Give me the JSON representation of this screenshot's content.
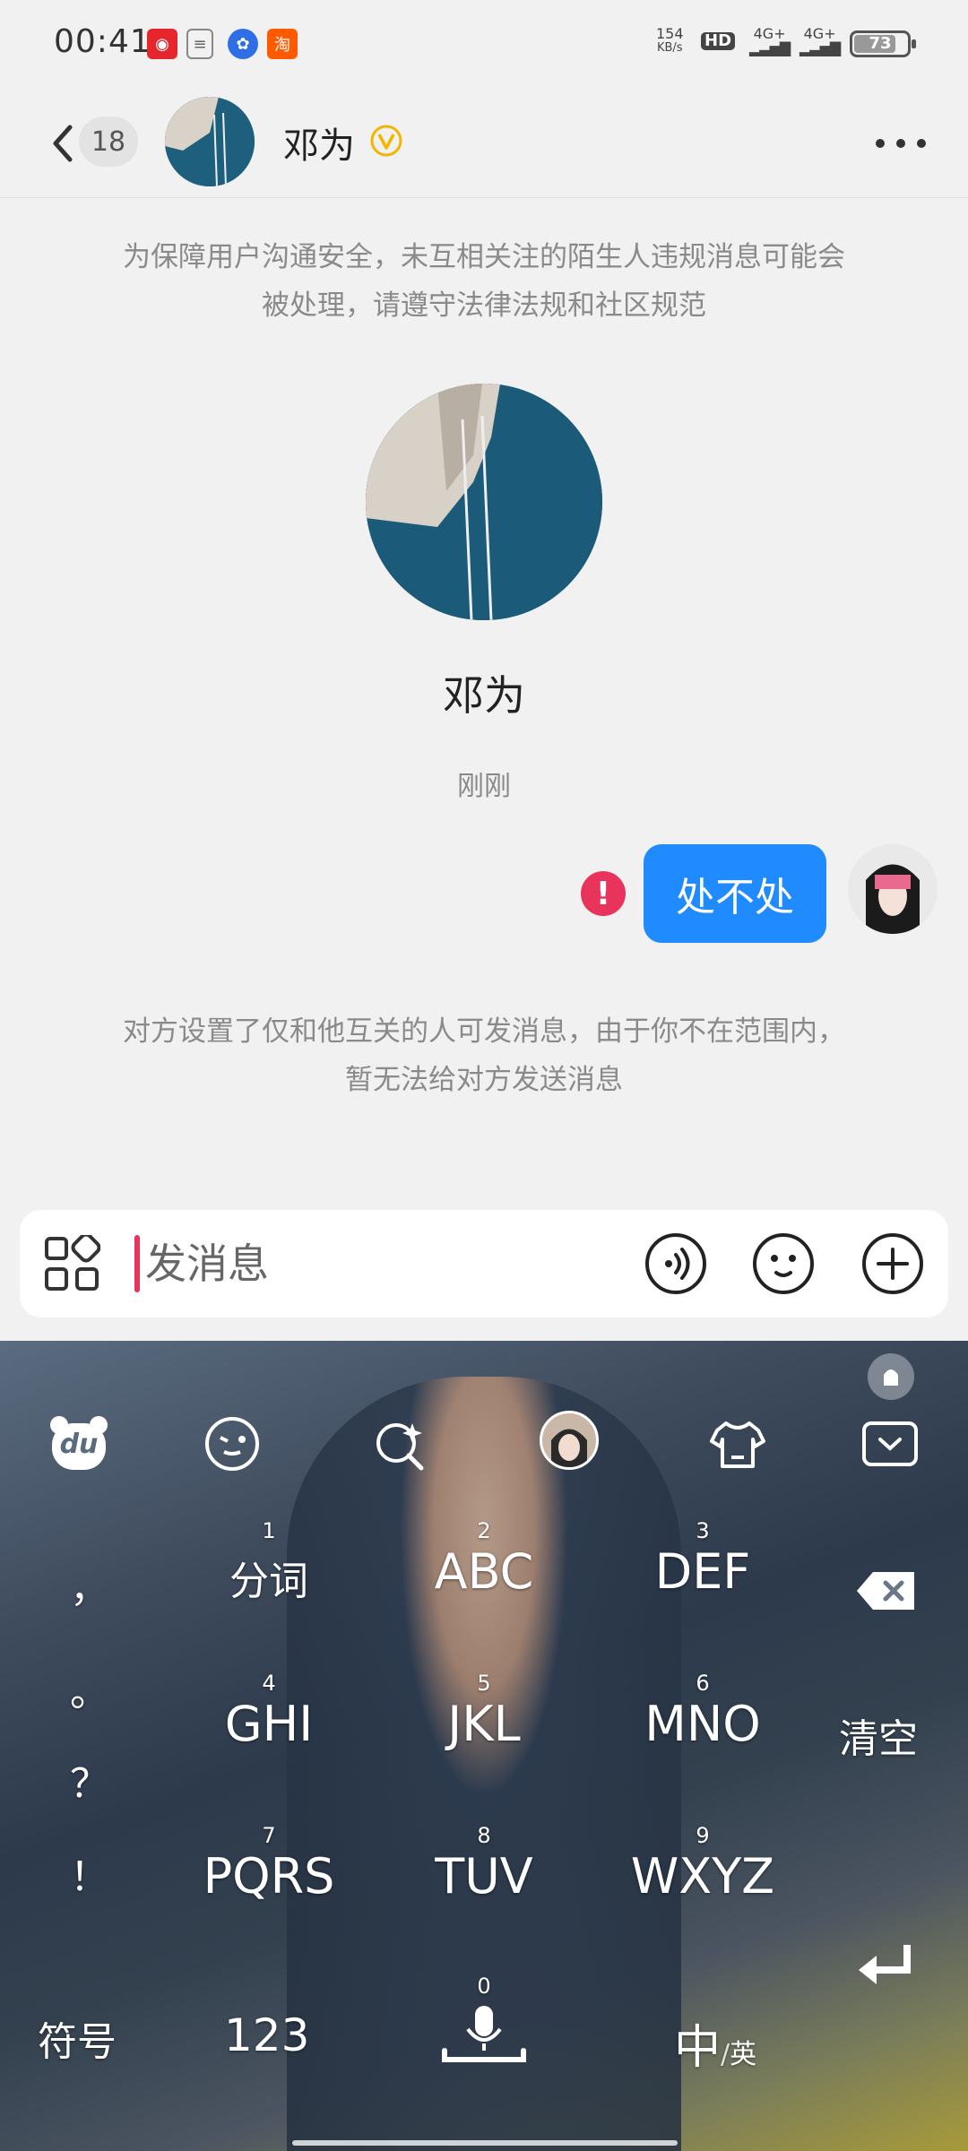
{
  "status_bar": {
    "time": "00:41",
    "net_speed_value": "154",
    "net_speed_unit": "KB/s",
    "hd": "HD",
    "sim1": "4G+",
    "sim2": "4G+",
    "battery": "73",
    "notification_icons": [
      "weibo-icon",
      "document-icon",
      "baidu-icon",
      "taobao-icon"
    ]
  },
  "header": {
    "unread_count": "18",
    "contact_name": "邓为",
    "verified_badge": "V"
  },
  "chat": {
    "safety_notice": "为保障用户沟通安全，未互相关注的陌生人违规消息可能会被处理，请遵守法律法规和社区规范",
    "profile_name": "邓为",
    "timestamp": "刚刚",
    "sent_message": "处不处",
    "error_mark": "!",
    "blocked_notice": "对方设置了仅和他互关的人可发消息，由于你不在范围内，暂无法给对方发送消息"
  },
  "input": {
    "placeholder": "发消息"
  },
  "keyboard": {
    "left_column": [
      "，",
      "。",
      "？",
      "！"
    ],
    "keys": [
      {
        "num": "1",
        "label": "分词"
      },
      {
        "num": "2",
        "label": "ABC"
      },
      {
        "num": "3",
        "label": "DEF"
      },
      {
        "num": "4",
        "label": "GHI"
      },
      {
        "num": "5",
        "label": "JKL"
      },
      {
        "num": "6",
        "label": "MNO"
      },
      {
        "num": "7",
        "label": "PQRS"
      },
      {
        "num": "8",
        "label": "TUV"
      },
      {
        "num": "9",
        "label": "WXYZ"
      }
    ],
    "clear": "清空",
    "symbols": "符号",
    "numbers": "123",
    "space_num": "0",
    "lang_main": "中",
    "lang_alt": "英",
    "du_logo": "du"
  },
  "colors": {
    "accent_blue": "#1f8bff",
    "error_red": "#e8335a",
    "verified_gold": "#f5b400"
  }
}
